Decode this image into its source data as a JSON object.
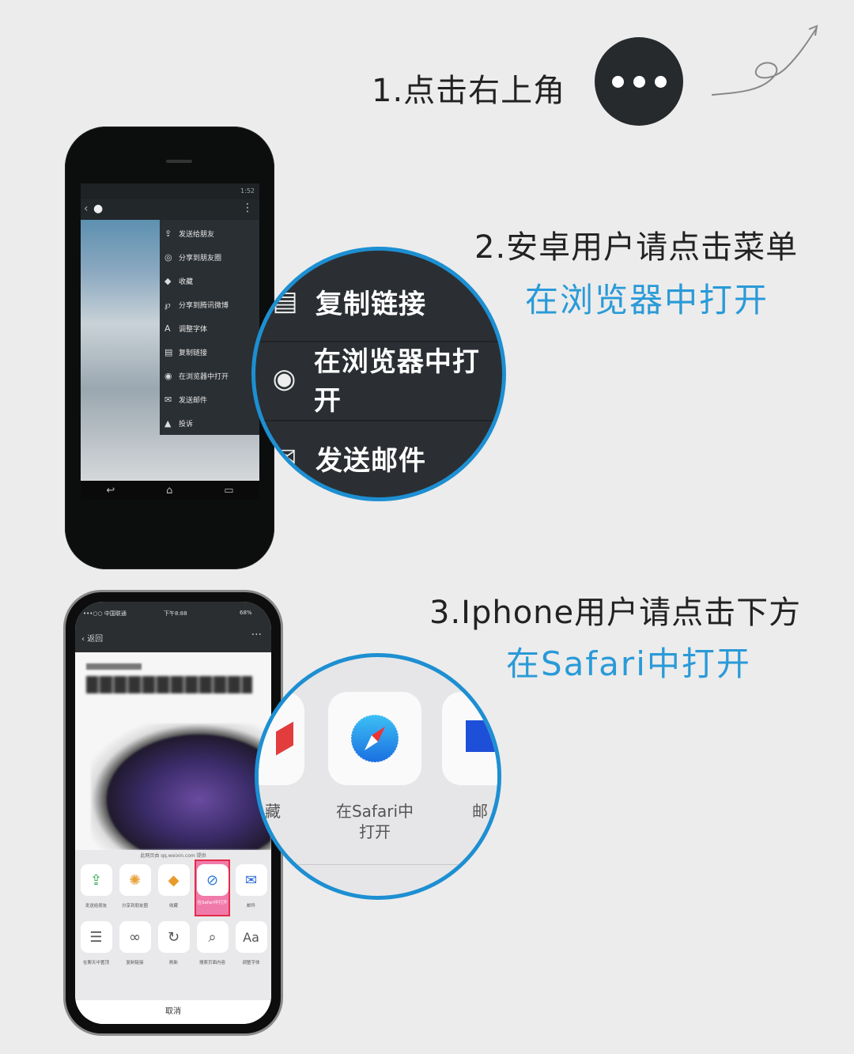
{
  "steps": {
    "step1": "1.点击右上角",
    "step2_line1": "2.安卓用户请点击菜单",
    "step2_line2": "在浏览器中打开",
    "step3_line1": "3.Iphone用户请点击下方",
    "step3_line2": "在Safari中打开"
  },
  "android": {
    "status_time": "1:52",
    "menu": [
      {
        "icon": "share-icon",
        "label": "发送给朋友"
      },
      {
        "icon": "moments-icon",
        "label": "分享到朋友圈"
      },
      {
        "icon": "favorite-icon",
        "label": "收藏"
      },
      {
        "icon": "weibo-icon",
        "label": "分享到腾讯微博"
      },
      {
        "icon": "font-icon",
        "label": "调整字体"
      },
      {
        "icon": "copy-icon",
        "label": "复制链接"
      },
      {
        "icon": "globe-icon",
        "label": "在浏览器中打开"
      },
      {
        "icon": "mail-icon",
        "label": "发送邮件"
      },
      {
        "icon": "report-icon",
        "label": "投诉"
      }
    ]
  },
  "magnifier_android": {
    "item1": "复制链接",
    "item2": "在浏览器中打开",
    "item3": "发送邮件"
  },
  "iphone": {
    "status": {
      "carrier": "•••○○ 中国联通",
      "time": "下午8:88",
      "battery": "68%"
    },
    "nav_back": "返回",
    "source": "此网页由 qq.weixin.com 提供",
    "row1": [
      "发送给朋友",
      "分享到朋友圈",
      "收藏",
      "在Safari中打开",
      "邮件"
    ],
    "row2": [
      "在聊天中置顶",
      "复制链接",
      "刷新",
      "搜索页面内容",
      "调整字体"
    ],
    "cancel": "取消"
  },
  "magnifier_iphone": {
    "left_cap": "藏",
    "center_cap_line1": "在Safari中",
    "center_cap_line2": "打开",
    "right_cap": "邮"
  },
  "colors": {
    "accent": "#1d8fd2",
    "highlight": "#e42c4a"
  }
}
